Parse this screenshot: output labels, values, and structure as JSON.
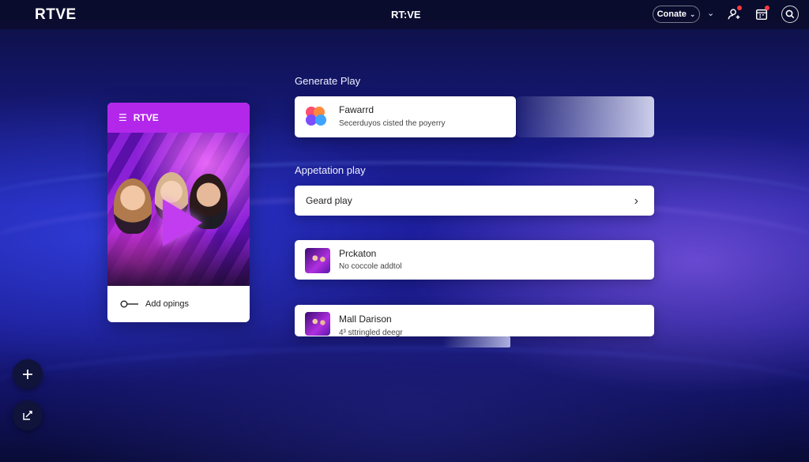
{
  "app": {
    "logo": "RTVE",
    "center_title": "RT:VE"
  },
  "header": {
    "dropdown_label": "Conate",
    "icons": [
      "user-plus-icon",
      "calendar-icon",
      "search-icon"
    ]
  },
  "media_card": {
    "header_label": "RTVE",
    "footer_label": "Add opings"
  },
  "sections": {
    "generate_label": "Generate Play",
    "appetation_label": "Appetation play"
  },
  "featured": {
    "title": "Fawarrd",
    "subtitle": "Secerduyos cisted the poyerry"
  },
  "play_row": {
    "label": "Geard play"
  },
  "list_items": [
    {
      "title": "Prckaton",
      "subtitle": "No coccole addtol"
    },
    {
      "title": "Mall Darison",
      "subtitle": "4³ sttringled deegr"
    }
  ],
  "colors": {
    "accent": "#b327ea",
    "notification": "#ff3b3b",
    "topbar": "#0c0f3e"
  }
}
